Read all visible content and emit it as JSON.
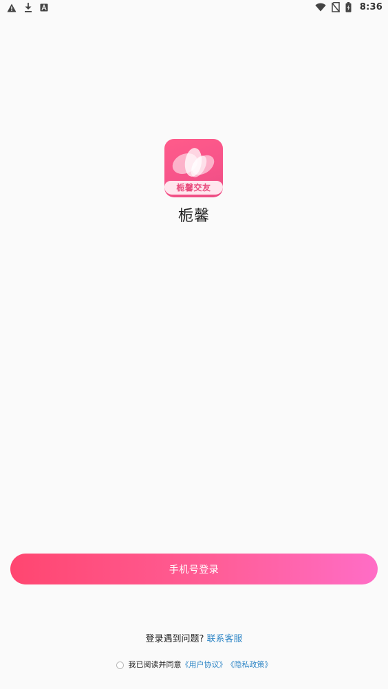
{
  "status_bar": {
    "time": "8:36",
    "left_icons": [
      "warning-icon",
      "download-icon",
      "font-a-icon"
    ],
    "right_icons": [
      "wifi-icon",
      "no-sim-icon",
      "battery-icon"
    ]
  },
  "app": {
    "logo_text": "栀馨交友",
    "name": "栀馨"
  },
  "login": {
    "button_label": "手机号登录"
  },
  "help": {
    "question": "登录遇到问题?",
    "contact_link": "联系客服"
  },
  "agreement": {
    "prefix": "我已阅读并同意",
    "user_agreement": "《用户协议》",
    "privacy_policy": "《隐私政策》"
  },
  "colors": {
    "background": "#fafafa",
    "brand_pink": "#f7548a",
    "button_gradient_start": "#ff4670",
    "button_gradient_end": "#ff6dc6",
    "link_blue": "#2f86c6"
  }
}
